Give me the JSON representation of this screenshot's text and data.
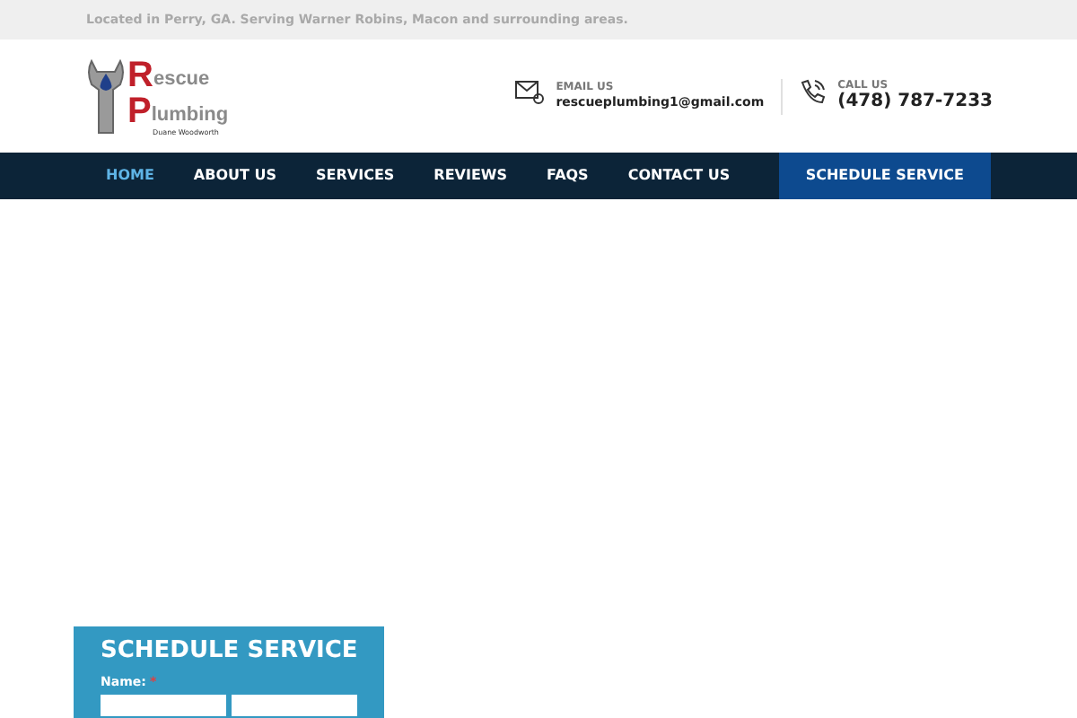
{
  "top_bar": {
    "text": "Located in Perry, GA. Serving Warner Robins, Macon and surrounding areas."
  },
  "logo": {
    "lines": [
      {
        "initial": "R",
        "rest": "escue"
      },
      {
        "initial": "P",
        "rest": "lumbing"
      }
    ],
    "tagline": "Duane Woodworth"
  },
  "contacts": [
    {
      "kind": "email",
      "label": "EMAIL US",
      "value": "rescueplumbing1@gmail.com"
    },
    {
      "kind": "phone",
      "label": "CALL US",
      "value": "(478) 787-7233"
    }
  ],
  "nav": {
    "items": [
      {
        "label": "HOME",
        "selected": true
      },
      {
        "label": "ABOUT US",
        "selected": false
      },
      {
        "label": "SERVICES",
        "selected": false
      },
      {
        "label": "REVIEWS",
        "selected": false
      },
      {
        "label": "FAQS",
        "selected": false
      },
      {
        "label": "CONTACT US",
        "selected": false
      }
    ],
    "cta": "SCHEDULE SERVICE"
  },
  "form": {
    "title": "SCHEDULE SERVICE",
    "field_label": "Name:",
    "required_mark": "*"
  }
}
